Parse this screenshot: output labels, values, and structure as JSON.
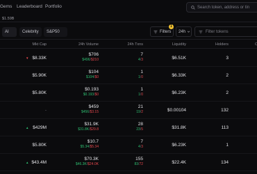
{
  "nav": {
    "links": [
      "Gems",
      "Leaderboard",
      "Portfolio"
    ],
    "search_placeholder": "Search token, address or tin"
  },
  "price_readout": "$1.59B",
  "filter_chips": [
    "AI",
    "Celebrity",
    "S&P50"
  ],
  "toolbar": {
    "filters_label": "Filters",
    "filters_count": "1",
    "interval": "24h",
    "token_filter_placeholder": "Filter tokens"
  },
  "table": {
    "headers": {
      "mkt_cap": "Mkt Cap",
      "volume": "24h Volume",
      "txns": "24h Txns",
      "liquidity": "Liquidity",
      "holders": "Holders",
      "extra": "Ch"
    },
    "rows": [
      {
        "dir": "down",
        "mkt_cap": "$8.33K",
        "vol": "$706",
        "vol_buy": "$496",
        "vol_sell": "$210",
        "txns": "7",
        "buys": "4",
        "sells": "3",
        "liquidity": "$6.51K",
        "holders": "3"
      },
      {
        "dir": "",
        "mkt_cap": "$5.90K",
        "vol": "$104",
        "vol_buy": "$104",
        "vol_sell": "$0",
        "txns": "1",
        "buys": "1",
        "sells": "0",
        "liquidity": "$6.33K",
        "holders": "2"
      },
      {
        "dir": "",
        "mkt_cap": "$5.80K",
        "vol": "$0.193",
        "vol_buy": "$0.193",
        "vol_sell": "$0",
        "txns": "1",
        "buys": "1",
        "sells": "0",
        "liquidity": "$6.23K",
        "holders": "2"
      },
      {
        "dir": "",
        "mkt_cap": "-",
        "vol": "$459",
        "vol_buy": "$456",
        "vol_sell": "$3.15",
        "txns": "21",
        "buys": "19",
        "sells": "2",
        "liquidity": "$0.00104",
        "holders": "132"
      },
      {
        "dir": "up",
        "mkt_cap": "$429M",
        "vol": "$31.9K",
        "vol_buy": "$31.8K",
        "vol_sell": "$29.8",
        "txns": "28",
        "buys": "23",
        "sells": "5",
        "liquidity": "$31.8K",
        "holders": "113"
      },
      {
        "dir": "",
        "mkt_cap": "$5.80K",
        "vol": "$10.7",
        "vol_buy": "$5.34",
        "vol_sell": "$5.34",
        "txns": "7",
        "buys": "4",
        "sells": "3",
        "liquidity": "$6.23K",
        "holders": "1"
      },
      {
        "dir": "up",
        "mkt_cap": "$43.4M",
        "vol": "$70.3K",
        "vol_buy": "$46.3K",
        "vol_sell": "$24.0K",
        "txns": "155",
        "buys": "83",
        "sells": "72",
        "liquidity": "$22.4K",
        "holders": "134"
      }
    ]
  },
  "colors": {
    "buy": "#2fbf71",
    "sell": "#e5484d",
    "badge": "#f2c230"
  }
}
